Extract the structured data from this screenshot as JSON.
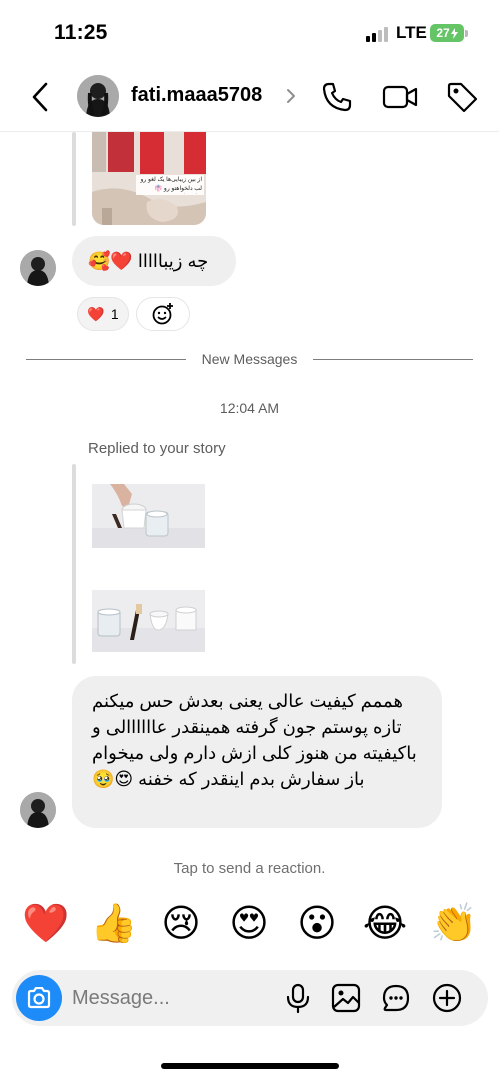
{
  "status_bar": {
    "time": "11:25",
    "network": "LTE",
    "battery": "27"
  },
  "header": {
    "username": "fati.maaa5708"
  },
  "messages": {
    "reaction_message": "چه زیبااااا ❤️🥰",
    "reaction": {
      "emoji": "❤️",
      "count": "1"
    },
    "new_messages_label": "New Messages",
    "timestamp": "12:04 AM",
    "replied_label": "Replied to your story",
    "story_caption": "از بین زیبایی‌ها یک لغو رو لب دلخواهتو رو 👘 میگیره🥳",
    "long_message": "هممم کیفیت عالی یعنی بعدش حس میکنم تازه پوستم جون گرفته همینقدر عاااااالی و باکیفیته من هنوز کلی ازش دارم ولی میخوام باز سفارش بدم اینقدر که خفنه 😍🥹"
  },
  "tap_reaction": "Tap to send a reaction.",
  "quick_reactions": [
    "❤️",
    "👍",
    "😢",
    "😍",
    "😮",
    "😂",
    "👏"
  ],
  "composer": {
    "placeholder": "Message..."
  },
  "colors": {
    "accent": "#1d8cf8",
    "bubble": "#efefef",
    "battery": "#65c466"
  }
}
